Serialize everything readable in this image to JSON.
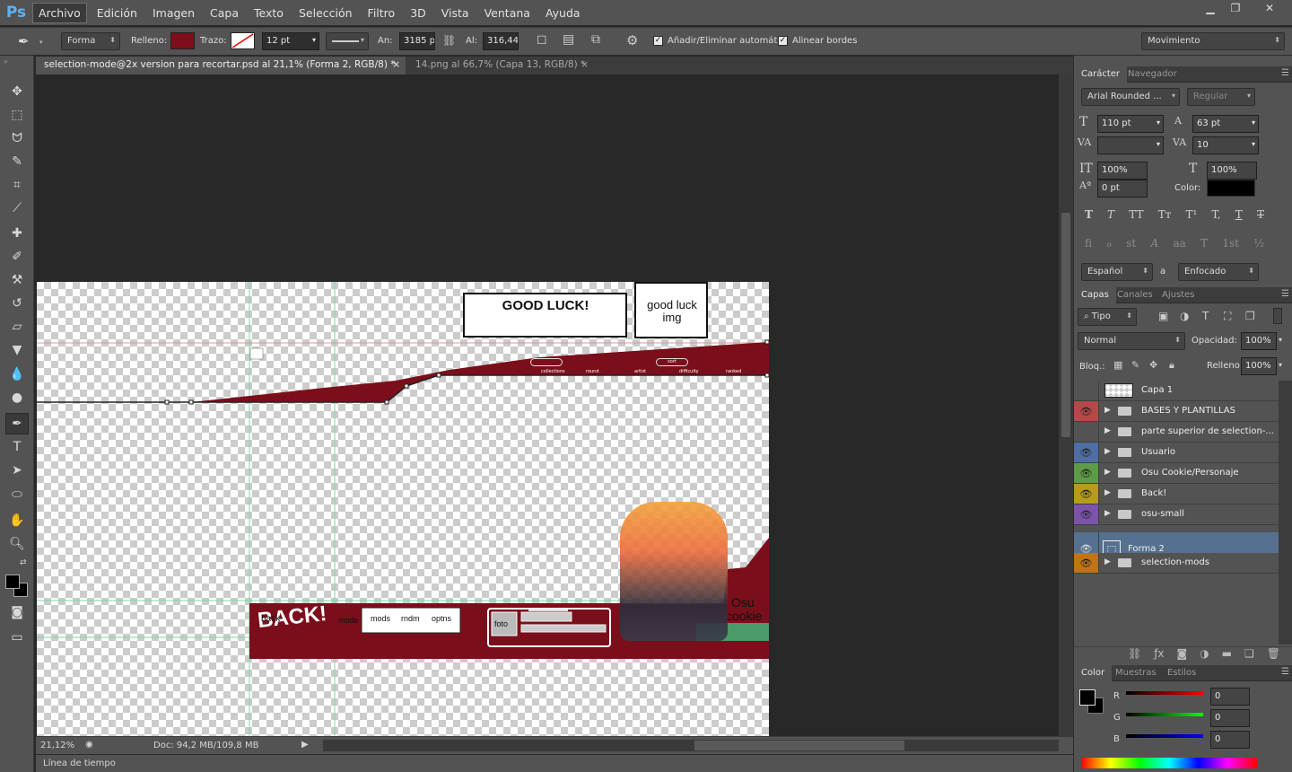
{
  "app": {
    "logo": "Ps"
  },
  "menu": [
    "Archivo",
    "Edición",
    "Imagen",
    "Capa",
    "Texto",
    "Selección",
    "Filtro",
    "3D",
    "Vista",
    "Ventana",
    "Ayuda"
  ],
  "options": {
    "mode": "Forma",
    "fill_label": "Relleno:",
    "fill_color": "#7e0e1b",
    "stroke_label": "Trazo:",
    "stroke_size": "12 pt",
    "width_label": "An:",
    "width_value": "3185 px",
    "height_label": "Al:",
    "height_value": "316,44 p",
    "auto_add_delete": "Añadir/Eliminar automát.",
    "align_edges": "Alinear bordes",
    "workspace": "Movimiento"
  },
  "tabs": [
    {
      "label": "selection-mode@2x version para recortar.psd al 21,1% (Forma 2, RGB/8) *",
      "close": "×"
    },
    {
      "label": "14.png al 66,7% (Capa 13, RGB/8) *",
      "close": "×"
    }
  ],
  "canvas": {
    "good_luck": "GOOD LUCK!",
    "good_luck_img_1": "good luck",
    "good_luck_img_2": "img",
    "back_big": "BACK!",
    "back_small": "back",
    "mode": "mode",
    "mods": "mods",
    "rndm": "rndm",
    "optns": "optns",
    "foto": "foto",
    "osu_1": "Osu",
    "osu_2": "cookie",
    "header_pills": [
      "",
      "sort"
    ],
    "header_items": [
      "collections",
      "round",
      "artist",
      "difficulty",
      "ranked"
    ],
    "character_label": "",
    "colors": {
      "maroon": "#7a0f1b",
      "guide": "#7fd6a6"
    }
  },
  "status": {
    "zoom": "21,12%",
    "doc": "Doc: 94,2 MB/109,8 MB"
  },
  "timeline": "Línea de tiempo",
  "character": {
    "tabs": [
      "Carácter",
      "Navegador"
    ],
    "font": "Arial Rounded ...",
    "style": "Regular",
    "size": "110 pt",
    "leading": "63 pt",
    "kerning": "",
    "tracking": "10",
    "vscale": "100%",
    "hscale": "100%",
    "baseline": "0 pt",
    "color_label": "Color:",
    "language": "Español",
    "aa_label": "a",
    "antialias": "Enfocado",
    "styles_row1": [
      "T",
      "T",
      "TT",
      "Tт",
      "T¹",
      "T,",
      "T",
      "T"
    ],
    "styles_row2": [
      "fi",
      "ℴ",
      "st",
      "A",
      "aa",
      "T",
      "1st",
      "½"
    ]
  },
  "layers_panel": {
    "tabs": [
      "Capas",
      "Canales",
      "Ajustes"
    ],
    "filter": "Tipo",
    "blend": "Normal",
    "opacity_label": "Opacidad:",
    "opacity": "100%",
    "lock_label": "Bloq.:",
    "fill_label": "Relleno:",
    "fill": "100%",
    "layers": [
      {
        "name": "Capa 1",
        "color": "",
        "visible": false,
        "type": "pixel"
      },
      {
        "name": "BASES Y PLANTILLAS",
        "color": "#b74848",
        "visible": true,
        "type": "group"
      },
      {
        "name": "parte superior de selection-...",
        "color": "",
        "visible": false,
        "type": "group"
      },
      {
        "name": "Usuario",
        "color": "#4f6fa4",
        "visible": true,
        "type": "group"
      },
      {
        "name": "Osu Cookie/Personaje",
        "color": "#5f9a48",
        "visible": true,
        "type": "group"
      },
      {
        "name": "Back!",
        "color": "#b69b1c",
        "visible": true,
        "type": "group"
      },
      {
        "name": "osu-small",
        "color": "#7b54a9",
        "visible": true,
        "type": "group"
      },
      {
        "name": "Forma 2",
        "color": "",
        "visible": true,
        "type": "shape",
        "selected": true
      },
      {
        "name": "selection-mods",
        "color": "#bf7416",
        "visible": true,
        "type": "group"
      }
    ]
  },
  "color_panel": {
    "tabs": [
      "Color",
      "Muestras",
      "Estilos"
    ],
    "r_label": "R",
    "g_label": "G",
    "b_label": "B",
    "r": "0",
    "g": "0",
    "b": "0"
  }
}
